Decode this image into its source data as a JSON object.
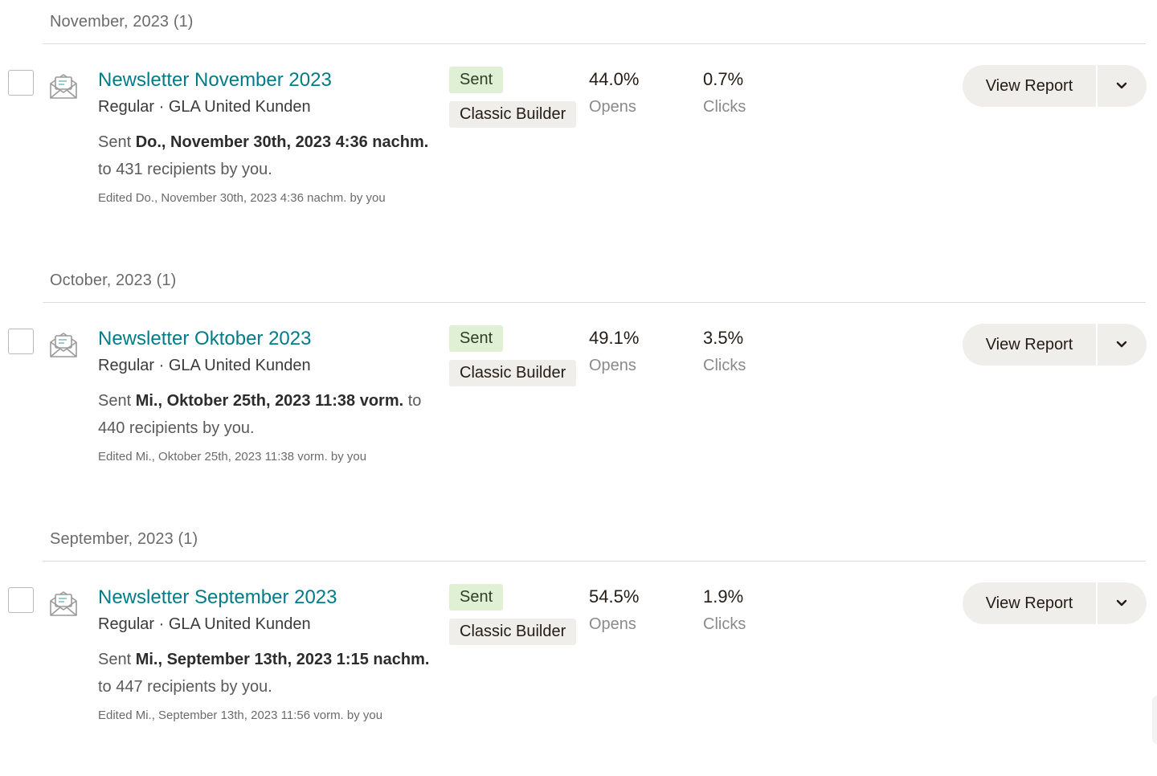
{
  "groups": [
    {
      "header": "November, 2023 (1)",
      "campaign": {
        "title": "Newsletter November 2023",
        "meta": "Regular · GLA United Kunden",
        "sent_prefix": "Sent ",
        "sent_date": "Do., November 30th, 2023 4:36 nachm.",
        "sent_suffix": " to 431 recipients by you.",
        "edited": "Edited Do., November 30th, 2023 4:36 nachm. by you",
        "status_badge": "Sent",
        "builder_badge": "Classic Builder",
        "opens_value": "44.0%",
        "opens_label": "Opens",
        "clicks_value": "0.7%",
        "clicks_label": "Clicks",
        "view_report_label": "View Report"
      }
    },
    {
      "header": "October, 2023 (1)",
      "campaign": {
        "title": "Newsletter Oktober 2023",
        "meta": "Regular · GLA United Kunden",
        "sent_prefix": "Sent ",
        "sent_date": "Mi., Oktober 25th, 2023 11:38 vorm.",
        "sent_suffix": " to 440 recipients by you.",
        "edited": "Edited Mi., Oktober 25th, 2023 11:38 vorm. by you",
        "status_badge": "Sent",
        "builder_badge": "Classic Builder",
        "opens_value": "49.1%",
        "opens_label": "Opens",
        "clicks_value": "3.5%",
        "clicks_label": "Clicks",
        "view_report_label": "View Report"
      }
    },
    {
      "header": "September, 2023 (1)",
      "campaign": {
        "title": "Newsletter September 2023",
        "meta": "Regular · GLA United Kunden",
        "sent_prefix": "Sent ",
        "sent_date": "Mi., September 13th, 2023 1:15 nachm.",
        "sent_suffix": " to 447 recipients by you.",
        "edited": "Edited Mi., September 13th, 2023 11:56 vorm. by you",
        "status_badge": "Sent",
        "builder_badge": "Classic Builder",
        "opens_value": "54.5%",
        "opens_label": "Opens",
        "clicks_value": "1.9%",
        "clicks_label": "Clicks",
        "view_report_label": "View Report"
      }
    }
  ],
  "icons": {
    "campaign": "email-campaign-icon",
    "dropdown": "chevron-down-icon"
  },
  "colors": {
    "title_link": "#007c89",
    "sent_badge_bg": "#dff0d5",
    "builder_badge_bg": "#efeeea",
    "button_bg": "#efeeea"
  }
}
